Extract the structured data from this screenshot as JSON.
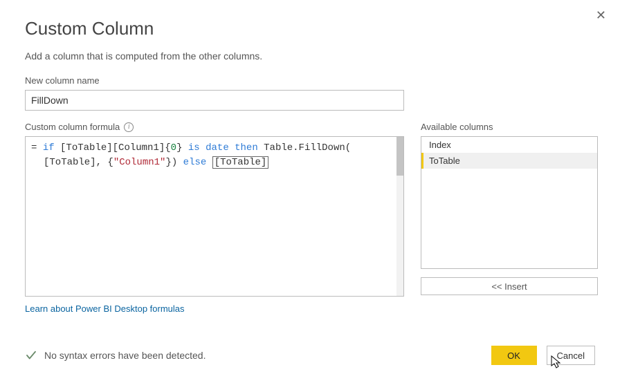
{
  "dialog": {
    "title": "Custom Column",
    "subtitle": "Add a column that is computed from the other columns.",
    "close_glyph": "✕"
  },
  "name_field": {
    "label": "New column name",
    "value": "FillDown"
  },
  "formula_field": {
    "label": "Custom column formula",
    "info_glyph": "i",
    "tokens": {
      "eq": "=",
      "if": "if",
      "br1": "[ToTable][Column1]{",
      "zero": "0",
      "br2": "}",
      "is": "is",
      "date": "date",
      "then": "then",
      "fn": "Table.FillDown(",
      "arg1": "[ToTable], {",
      "str": "\"Column1\"",
      "arg2": "})",
      "else": "else",
      "boxed_open": "[",
      "boxed_mid": "ToTable",
      "boxed_close": "]"
    }
  },
  "available": {
    "label": "Available columns",
    "items": [
      {
        "label": "Index",
        "selected": false
      },
      {
        "label": "ToTable",
        "selected": true
      }
    ],
    "insert_label": "<< Insert"
  },
  "learn_link": "Learn about Power BI Desktop formulas",
  "status": {
    "text": "No syntax errors have been detected."
  },
  "buttons": {
    "ok": "OK",
    "cancel": "Cancel"
  }
}
